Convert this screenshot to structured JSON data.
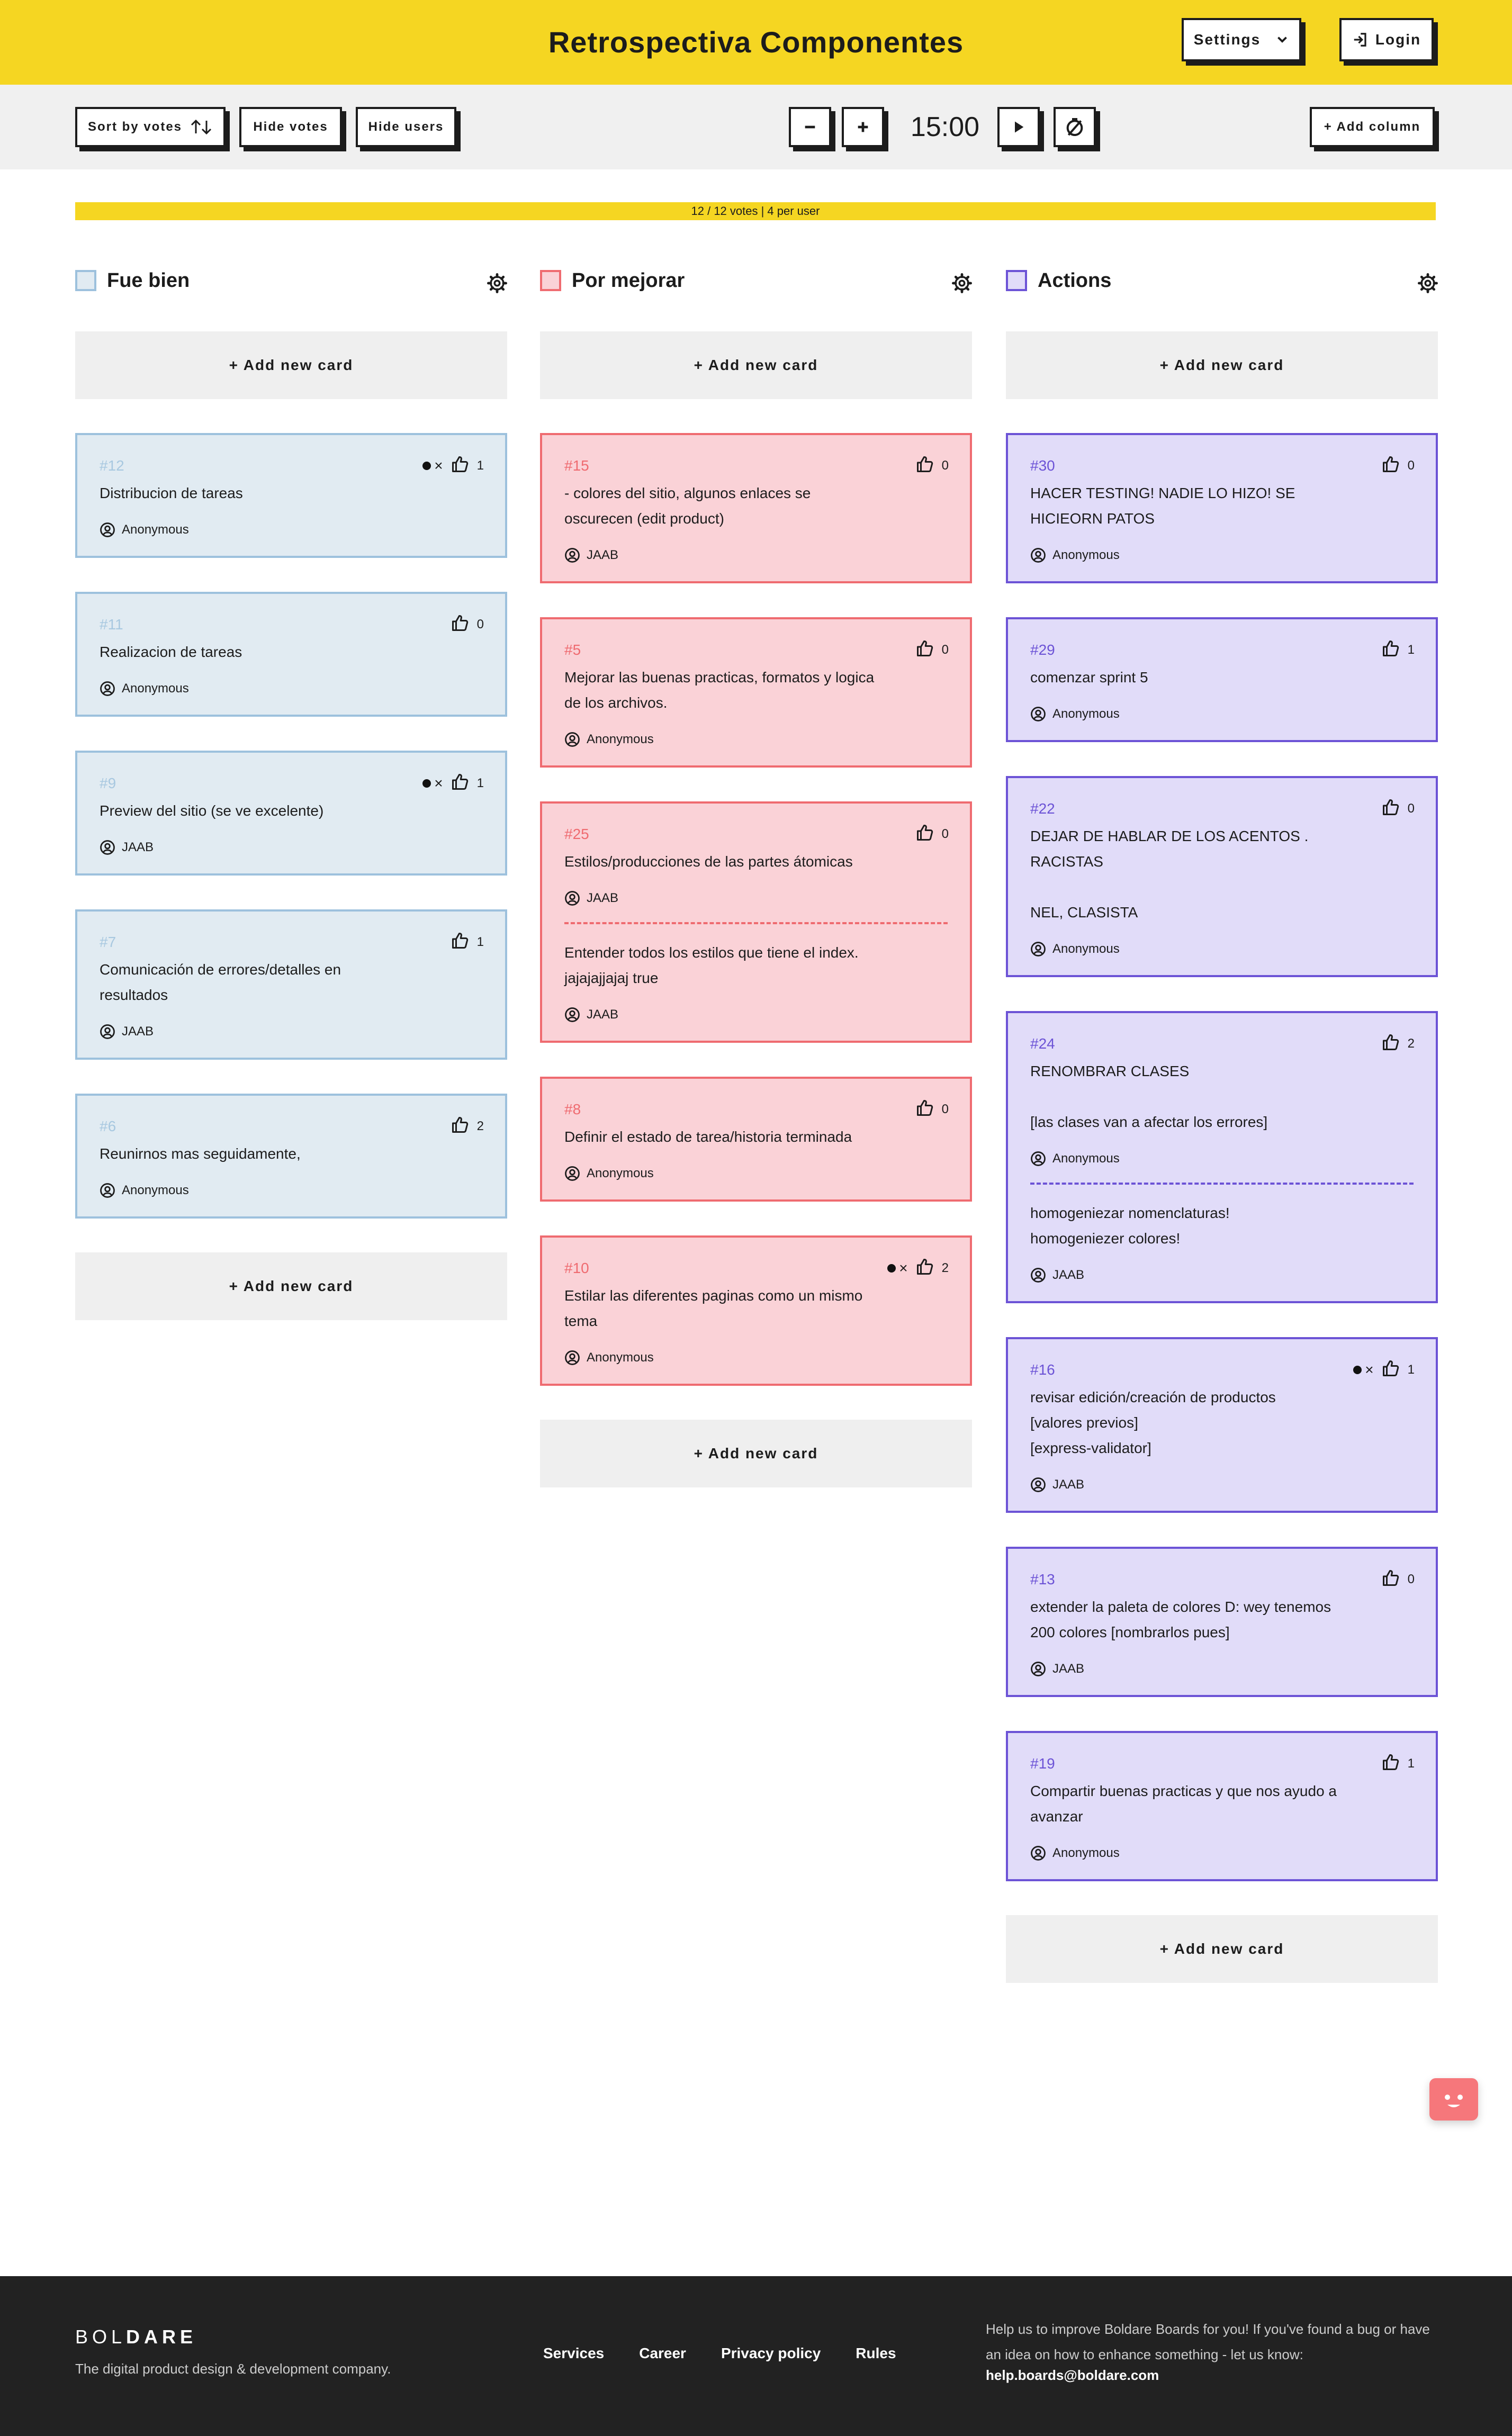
{
  "header": {
    "title": "Retrospectiva Componentes",
    "settings_label": "Settings",
    "login_label": "Login"
  },
  "toolbar": {
    "sort_label": "Sort by votes",
    "hide_votes_label": "Hide votes",
    "hide_users_label": "Hide users",
    "timer_value": "15:00",
    "add_column_label": "+ Add column"
  },
  "votes": {
    "used": 12,
    "total": 12,
    "fill_fraction": 1.0,
    "text": "12 / 12 votes | 4 per user"
  },
  "columns": [
    {
      "title": "Fue bien",
      "color": "#9dc1dd",
      "add_card_label": "+ Add new card",
      "cards": [
        {
          "id": "#12",
          "sections": [
            {
              "text": "Distribucion de tareas",
              "author": "Anonymous"
            }
          ],
          "votes": "1",
          "own_vote": true
        },
        {
          "id": "#11",
          "sections": [
            {
              "text": "Realizacion de tareas",
              "author": "Anonymous"
            }
          ],
          "votes": "0",
          "own_vote": false
        },
        {
          "id": "#9",
          "sections": [
            {
              "text": "Preview del sitio (se ve excelente)",
              "author": "JAAB"
            }
          ],
          "votes": "1",
          "own_vote": true
        },
        {
          "id": "#7",
          "sections": [
            {
              "text": "Comunicación de errores/detalles en\nresultados",
              "author": "JAAB"
            }
          ],
          "votes": "1",
          "own_vote": false
        },
        {
          "id": "#6",
          "sections": [
            {
              "text": "Reunirnos mas seguidamente,",
              "author": "Anonymous"
            }
          ],
          "votes": "2",
          "own_vote": false
        }
      ]
    },
    {
      "title": "Por mejorar",
      "color": "#ef6b70",
      "add_card_label": "+ Add new card",
      "cards": [
        {
          "id": "#15",
          "sections": [
            {
              "text": "- colores del sitio, algunos enlaces se\noscurecen (edit product)",
              "author": "JAAB"
            }
          ],
          "votes": "0",
          "own_vote": false
        },
        {
          "id": "#5",
          "sections": [
            {
              "text": "Mejorar las buenas practicas, formatos y logica\nde los archivos.",
              "author": "Anonymous"
            }
          ],
          "votes": "0",
          "own_vote": false
        },
        {
          "id": "#25",
          "sections": [
            {
              "text": "Estilos/producciones de las partes átomicas",
              "author": "JAAB"
            },
            {
              "text": "Entender todos los estilos que tiene el index.\njajajajjajaj true",
              "author": "JAAB"
            }
          ],
          "votes": "0",
          "own_vote": false
        },
        {
          "id": "#8",
          "sections": [
            {
              "text": "Definir el estado de tarea/historia terminada",
              "author": "Anonymous"
            }
          ],
          "votes": "0",
          "own_vote": false
        },
        {
          "id": "#10",
          "sections": [
            {
              "text": "Estilar las diferentes paginas como un mismo\ntema",
              "author": "Anonymous"
            }
          ],
          "votes": "2",
          "own_vote": true
        }
      ]
    },
    {
      "title": "Actions",
      "color": "#6c53d6",
      "add_card_label": "+ Add new card",
      "cards": [
        {
          "id": "#30",
          "sections": [
            {
              "text": "HACER TESTING! NADIE LO HIZO! SE\nHICIEORN PATOS",
              "author": "Anonymous"
            }
          ],
          "votes": "0",
          "own_vote": false
        },
        {
          "id": "#29",
          "sections": [
            {
              "text": "comenzar sprint 5",
              "author": "Anonymous"
            }
          ],
          "votes": "1",
          "own_vote": false
        },
        {
          "id": "#22",
          "sections": [
            {
              "text": "DEJAR DE HABLAR DE LOS ACENTOS .\nRACISTAS\n\nNEL, CLASISTA",
              "author": "Anonymous"
            }
          ],
          "votes": "0",
          "own_vote": false
        },
        {
          "id": "#24",
          "sections": [
            {
              "text": "RENOMBRAR CLASES\n\n[las clases van a afectar los errores]",
              "author": "Anonymous"
            },
            {
              "text": "homogeniezar nomenclaturas!\nhomogeniezer colores!",
              "author": "JAAB"
            }
          ],
          "votes": "2",
          "own_vote": false
        },
        {
          "id": "#16",
          "sections": [
            {
              "text": "revisar edición/creación de productos\n[valores previos]\n[express-validator]",
              "author": "JAAB"
            }
          ],
          "votes": "1",
          "own_vote": true
        },
        {
          "id": "#13",
          "sections": [
            {
              "text": "extender la paleta de colores D: wey tenemos\n200 colores [nombrarlos pues]",
              "author": "JAAB"
            }
          ],
          "votes": "0",
          "own_vote": false
        },
        {
          "id": "#19",
          "sections": [
            {
              "text": "Compartir buenas practicas y que nos ayudo a\navanzar",
              "author": "Anonymous"
            }
          ],
          "votes": "1",
          "own_vote": false
        }
      ]
    }
  ],
  "footer": {
    "logo_light": "BOL",
    "logo_bold": "DARE",
    "tagline": "The digital product design & development company.",
    "links": [
      "Services",
      "Career",
      "Privacy policy",
      "Rules"
    ],
    "help_text": "Help us to improve Boldare Boards for you! If you've found a bug or have an idea on how to enhance something - let us know:",
    "help_email": "help.boards@boldare.com"
  },
  "icons": {
    "settings_chevron": "chevron-down-icon",
    "login": "login-icon",
    "sort": "sort-arrows-icon",
    "minus": "minus-icon",
    "plus": "plus-icon",
    "play": "play-icon",
    "reset": "timer-reset-icon",
    "gear": "gear-icon",
    "vote": "thumbs-up-icon",
    "author": "user-circle-icon",
    "chat": "chat-bot-icon"
  }
}
